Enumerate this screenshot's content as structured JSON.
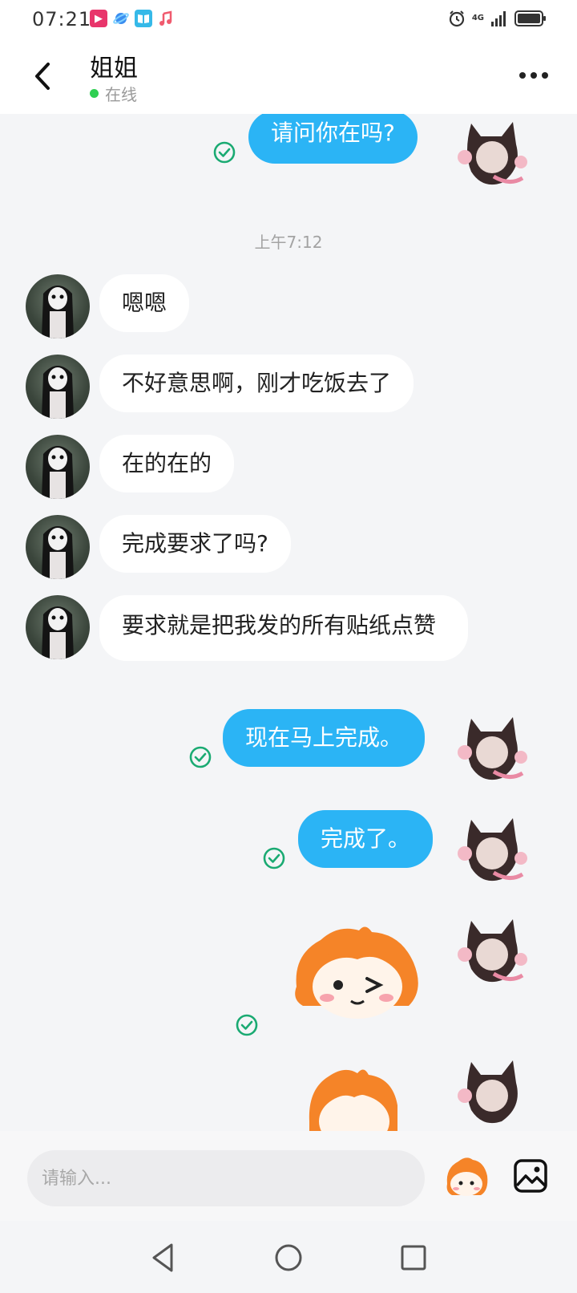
{
  "status_bar": {
    "time": "07:21",
    "app_icons": [
      "video-app-icon",
      "browser-app-icon",
      "reader-app-icon",
      "music-app-icon"
    ],
    "network": "4G",
    "icons": [
      "alarm-icon",
      "signal-icon",
      "battery-icon"
    ]
  },
  "header": {
    "contact_name": "姐姐",
    "status": "在线",
    "status_color": "#2fcf52"
  },
  "colors": {
    "outgoing_bubble": "#2bb4f5",
    "incoming_bubble": "#ffffff",
    "read_check": "#1aaa72",
    "background": "#f4f5f7"
  },
  "messages": [
    {
      "from": "me",
      "type": "text",
      "text": "请问你在吗?",
      "read": true
    },
    {
      "type": "timestamp",
      "text": "上午7:12"
    },
    {
      "from": "her",
      "type": "text",
      "text": "嗯嗯"
    },
    {
      "from": "her",
      "type": "text",
      "text": "不好意思啊，刚才吃饭去了"
    },
    {
      "from": "her",
      "type": "text",
      "text": "在的在的"
    },
    {
      "from": "her",
      "type": "text",
      "text": "完成要求了吗?"
    },
    {
      "from": "her",
      "type": "text",
      "text": "要求就是把我发的所有贴纸点赞"
    },
    {
      "from": "me",
      "type": "text",
      "text": "现在马上完成。",
      "read": true
    },
    {
      "from": "me",
      "type": "text",
      "text": "完成了。",
      "read": true
    },
    {
      "from": "me",
      "type": "sticker",
      "sticker": "winking-girl-sticker",
      "read": true
    },
    {
      "from": "me",
      "type": "sticker",
      "sticker": "girl-sticker-partial"
    }
  ],
  "input": {
    "placeholder": "请输入..."
  },
  "nav": [
    "back-triangle-icon",
    "home-circle-icon",
    "recents-square-icon"
  ]
}
